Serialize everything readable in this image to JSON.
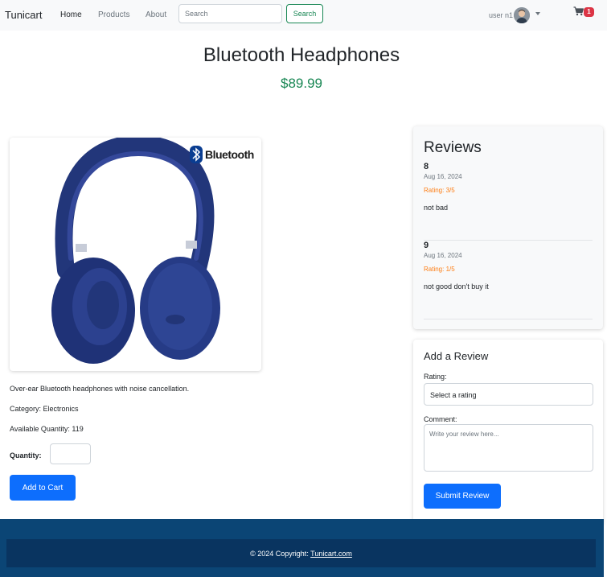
{
  "navbar": {
    "brand": "Tunicart",
    "links": [
      "Home",
      "Products",
      "About"
    ],
    "search_placeholder": "Search",
    "search_button": "Search",
    "user_label": "user n1",
    "cart_count": "1"
  },
  "product": {
    "title": "Bluetooth Headphones",
    "price": "$89.99",
    "image_logo_text": "Bluetooth",
    "description": "Over-ear Bluetooth headphones with noise cancellation.",
    "category": "Category: Electronics",
    "available": "Available Quantity: 119",
    "quantity_label": "Quantity:",
    "add_to_cart": "Add to Cart"
  },
  "reviews": {
    "title": "Reviews",
    "items": [
      {
        "user": "8",
        "date": "Aug 16, 2024",
        "rating": "Rating: 3/5",
        "comment": "not bad"
      },
      {
        "user": "9",
        "date": "Aug 16, 2024",
        "rating": "Rating: 1/5",
        "comment": "not good don't buy it"
      }
    ]
  },
  "add_review": {
    "title": "Add a Review",
    "rating_label": "Rating:",
    "rating_placeholder": "Select a rating",
    "comment_label": "Comment:",
    "comment_placeholder": "Write your review here...",
    "submit": "Submit Review"
  },
  "footer": {
    "text": "© 2024 Copyright: ",
    "link": "Tunicart.com"
  },
  "colors": {
    "primary": "#0d6efd",
    "success": "#198754",
    "danger": "#dc3545",
    "warning": "#fd7e14",
    "footer": "#0b4575"
  }
}
